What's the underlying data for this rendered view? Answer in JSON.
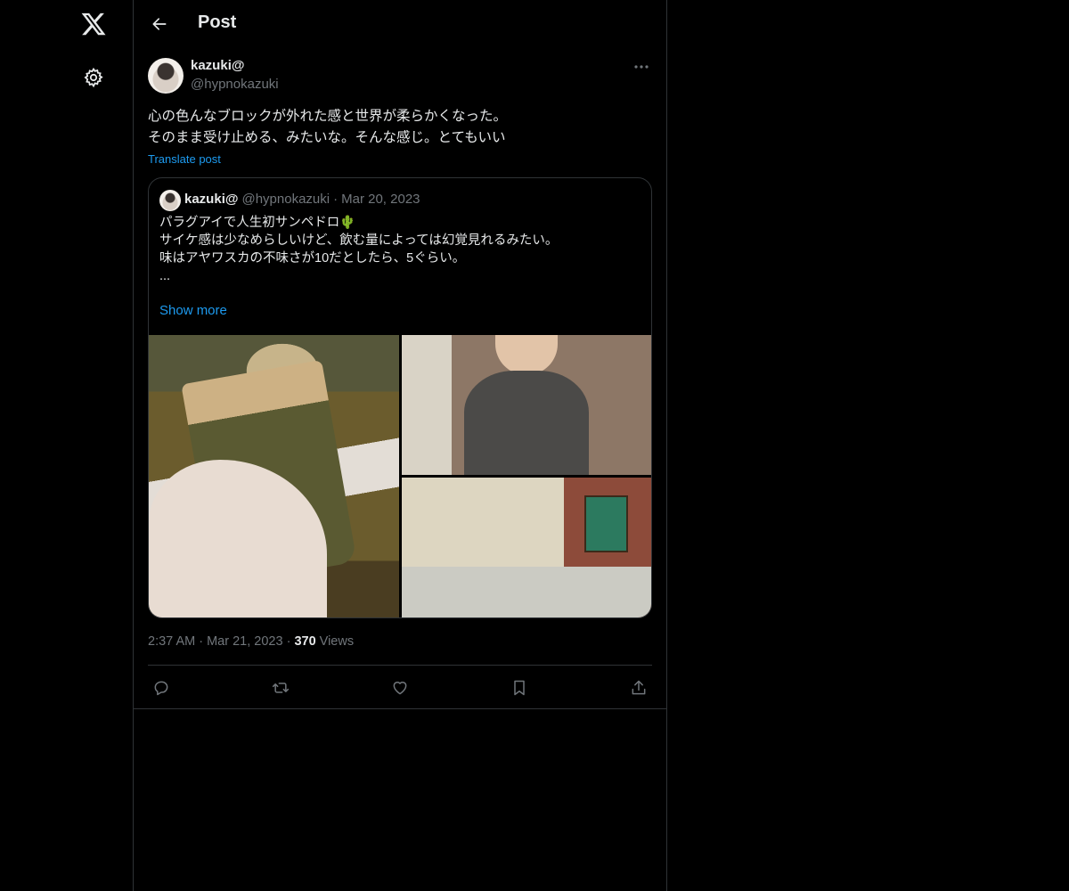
{
  "nav": {
    "logo_icon": "x-logo-icon",
    "settings_icon": "gear-icon"
  },
  "header": {
    "title": "Post",
    "back_icon": "arrow-left-icon"
  },
  "post": {
    "author_name": "kazuki@",
    "author_handle": "@hypnokazuki",
    "text": "心の色んなブロックが外れた感と世界が柔らかくなった。\nそのまま受け止める、みたいな。そんな感じ。とてもいい",
    "translate_label": "Translate post",
    "time": "2:37 AM",
    "date": "Mar 21, 2023",
    "views_count": "370",
    "views_label": "Views",
    "more_icon": "more-horizontal-icon"
  },
  "quote": {
    "author_name": "kazuki@",
    "author_handle": "@hypnokazuki",
    "date": "Mar 20, 2023",
    "text_line1": "パラグアイで人生初サンペドロ",
    "emoji": "🌵",
    "text_rest": "\nサイケ感は少なめらしいけど、飲む量によっては幻覚見れるみたい。\n味はアヤワスカの不味さが10だとしたら、5ぐらい。\n...",
    "show_more": "Show more"
  },
  "actions": {
    "reply_icon": "reply-icon",
    "retweet_icon": "retweet-icon",
    "like_icon": "heart-icon",
    "bookmark_icon": "bookmark-icon",
    "share_icon": "share-icon"
  },
  "colors": {
    "background": "#000000",
    "text": "#e7e9ea",
    "secondary": "#71767b",
    "accent": "#1d9bf0",
    "border": "#2f3336"
  }
}
